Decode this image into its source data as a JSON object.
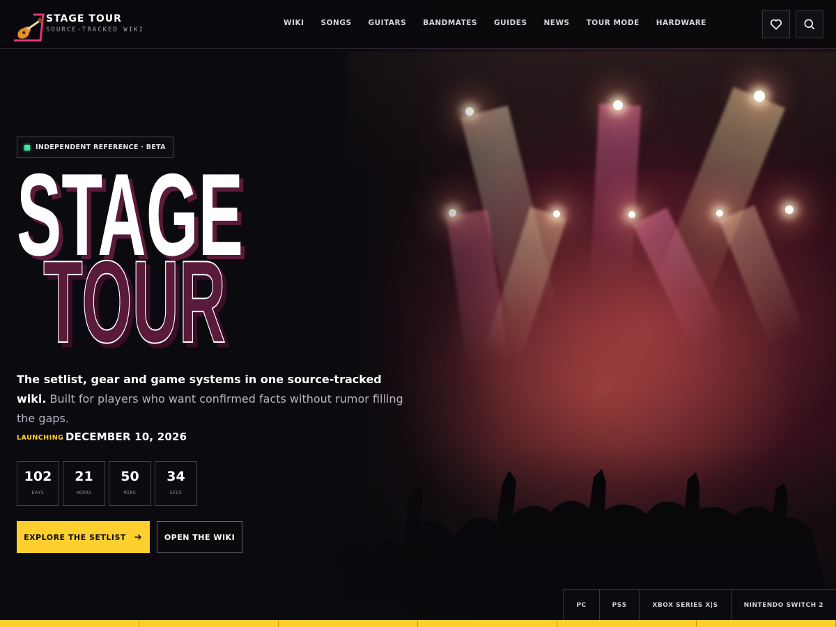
{
  "brand": {
    "name": "STAGE TOUR",
    "tagline": "SOURCE-TRACKED WIKI"
  },
  "nav": {
    "items": [
      "WIKI",
      "SONGS",
      "GUITARS",
      "BANDMATES",
      "GUIDES",
      "NEWS",
      "TOUR MODE",
      "HARDWARE"
    ]
  },
  "header_icons": [
    "heart-icon",
    "search-icon"
  ],
  "hero": {
    "badge": "INDEPENDENT REFERENCE · BETA",
    "title_line1": "STAGE",
    "title_line2": "TOUR",
    "lead_bold": "The setlist, gear and game systems in one source-tracked wiki.",
    "lead_rest": " Built for players who want confirmed facts without rumor filling the gaps.",
    "launch_label": "LAUNCHING",
    "launch_date": "DECEMBER 10, 2026",
    "countdown": [
      {
        "value": "102",
        "unit": "DAYS"
      },
      {
        "value": "21",
        "unit": "HOURS"
      },
      {
        "value": "50",
        "unit": "MINS"
      },
      {
        "value": "34",
        "unit": "SECS"
      }
    ],
    "primary_cta": "EXPLORE THE SETLIST",
    "secondary_cta": "OPEN THE WIKI"
  },
  "platforms": [
    "PC",
    "PS5",
    "XBOX SERIES X|S",
    "NINTENDO SWITCH 2"
  ],
  "colors": {
    "accent": "#ffcf2e",
    "brand_pink": "#e8327a",
    "status_green": "#3ee6a3",
    "title_shadow": "#5a1a3a"
  }
}
